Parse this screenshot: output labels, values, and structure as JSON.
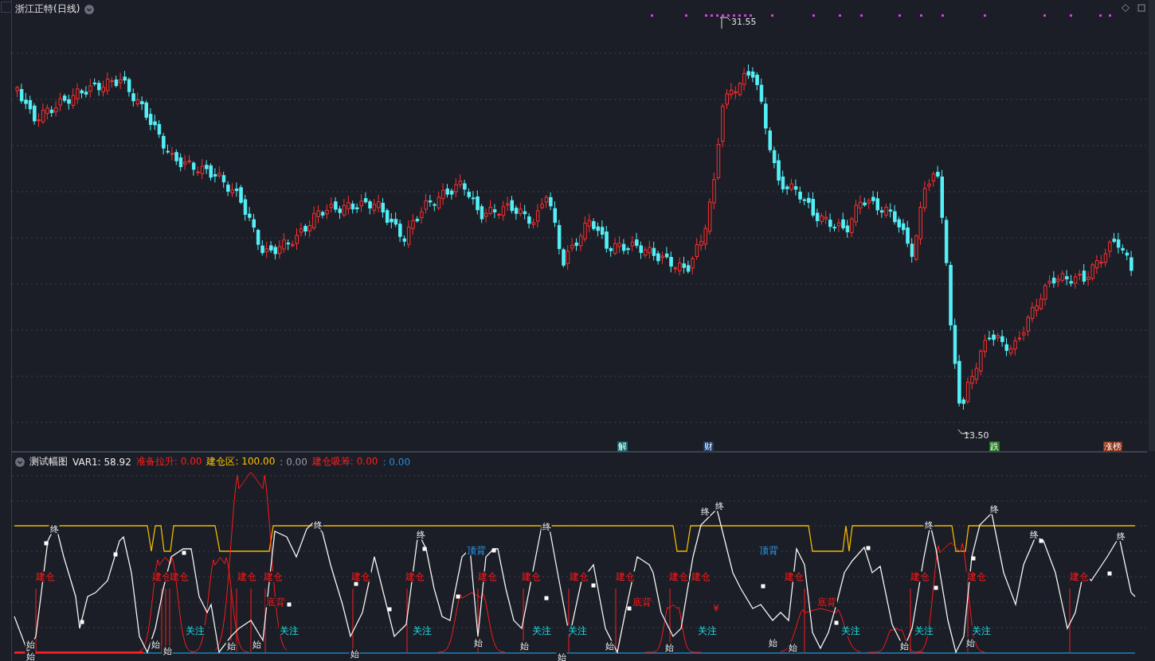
{
  "chart": {
    "title": "浙江正特(日线)",
    "high_label": "31.55",
    "low_label": "13.50",
    "event_tags": [
      {
        "text": "解",
        "kind": "unlock"
      },
      {
        "text": "财",
        "kind": "finance"
      },
      {
        "text": "跌",
        "kind": "down"
      },
      {
        "text": "涨榜",
        "kind": "rank"
      }
    ]
  },
  "indicator": {
    "title": "测试幅图",
    "values": [
      {
        "text": "VAR1: 58.92",
        "color": "#e8e8e8"
      },
      {
        "text": "准备拉升: 0.00",
        "color": "#ff2020"
      },
      {
        "text": "建仓区: 100.00",
        "color": "#ffc400"
      },
      {
        "text": ": 0.00",
        "color": "#9a9aa8"
      },
      {
        "text": "建仓吸筹: 0.00",
        "color": "#ff2020"
      },
      {
        "text": ": 0.00",
        "color": "#1e90e0"
      }
    ],
    "signals": [
      {
        "text": "建仓",
        "kind": "build"
      },
      {
        "text": "建仓",
        "kind": "build"
      },
      {
        "text": "建仓",
        "kind": "build"
      },
      {
        "text": "建仓",
        "kind": "build"
      },
      {
        "text": "建仓",
        "kind": "build"
      },
      {
        "text": "建仓",
        "kind": "build"
      },
      {
        "text": "建仓",
        "kind": "build"
      },
      {
        "text": "建仓",
        "kind": "build"
      },
      {
        "text": "建仓",
        "kind": "build"
      },
      {
        "text": "建仓",
        "kind": "build"
      },
      {
        "text": "建仓",
        "kind": "build"
      },
      {
        "text": "建仓",
        "kind": "build"
      },
      {
        "text": "建仓",
        "kind": "build"
      },
      {
        "text": "建仓",
        "kind": "build"
      },
      {
        "text": "建仓",
        "kind": "build"
      },
      {
        "text": "建仓",
        "kind": "build"
      },
      {
        "text": "建仓",
        "kind": "build"
      },
      {
        "text": "关注",
        "kind": "watch"
      },
      {
        "text": "关注",
        "kind": "watch"
      },
      {
        "text": "关注",
        "kind": "watch"
      },
      {
        "text": "关注",
        "kind": "watch"
      },
      {
        "text": "关注",
        "kind": "watch"
      },
      {
        "text": "关注",
        "kind": "watch"
      },
      {
        "text": "关注",
        "kind": "watch"
      },
      {
        "text": "关注",
        "kind": "watch"
      },
      {
        "text": "关注",
        "kind": "watch"
      },
      {
        "text": "顶背",
        "kind": "top"
      },
      {
        "text": "顶背",
        "kind": "top"
      },
      {
        "text": "底背",
        "kind": "bottom"
      },
      {
        "text": "底背",
        "kind": "bottom"
      },
      {
        "text": "底背",
        "kind": "bottom"
      },
      {
        "text": "¥",
        "kind": "yuan"
      },
      {
        "text": "终",
        "kind": "end"
      },
      {
        "text": "终",
        "kind": "end"
      },
      {
        "text": "终",
        "kind": "end"
      },
      {
        "text": "终",
        "kind": "end"
      },
      {
        "text": "终",
        "kind": "end"
      },
      {
        "text": "终",
        "kind": "end"
      },
      {
        "text": "终",
        "kind": "end"
      },
      {
        "text": "终",
        "kind": "end"
      },
      {
        "text": "终",
        "kind": "end"
      },
      {
        "text": "终",
        "kind": "end"
      },
      {
        "text": "始",
        "kind": "start"
      },
      {
        "text": "始",
        "kind": "start"
      },
      {
        "text": "始",
        "kind": "start"
      },
      {
        "text": "始",
        "kind": "start"
      },
      {
        "text": "始",
        "kind": "start"
      },
      {
        "text": "始",
        "kind": "start"
      },
      {
        "text": "始",
        "kind": "start"
      },
      {
        "text": "始",
        "kind": "start"
      },
      {
        "text": "始",
        "kind": "start"
      },
      {
        "text": "始",
        "kind": "start"
      },
      {
        "text": "始",
        "kind": "start"
      },
      {
        "text": "始",
        "kind": "start"
      },
      {
        "text": "始",
        "kind": "start"
      },
      {
        "text": "始",
        "kind": "start"
      },
      {
        "text": "始",
        "kind": "start"
      },
      {
        "text": "始",
        "kind": "start"
      }
    ]
  }
}
